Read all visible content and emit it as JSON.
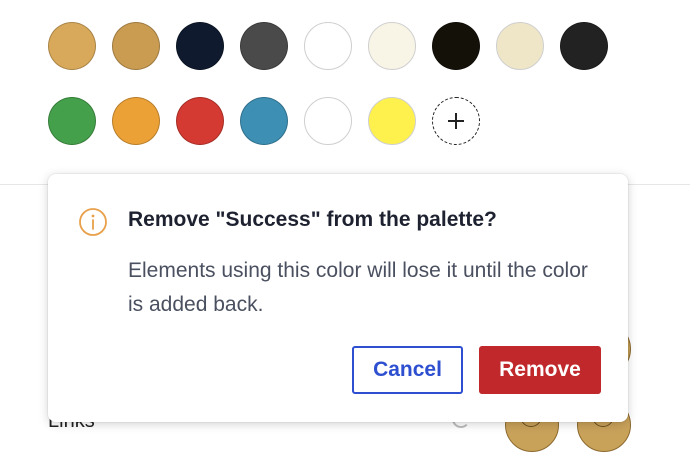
{
  "palette": {
    "row1": [
      {
        "name": "swatch-gold",
        "color": "#d8a95a"
      },
      {
        "name": "swatch-ochre",
        "color": "#c99c52"
      },
      {
        "name": "swatch-navy",
        "color": "#0f1a2e"
      },
      {
        "name": "swatch-dark-gray",
        "color": "#4a4a4a"
      },
      {
        "name": "swatch-white",
        "color": "#ffffff"
      },
      {
        "name": "swatch-ivory",
        "color": "#f8f5e6"
      },
      {
        "name": "swatch-black-olive",
        "color": "#141109"
      },
      {
        "name": "swatch-cream",
        "color": "#efe6c8"
      },
      {
        "name": "swatch-charcoal",
        "color": "#222222"
      }
    ],
    "row2": [
      {
        "name": "swatch-green",
        "color": "#45a04b"
      },
      {
        "name": "swatch-orange",
        "color": "#eba136"
      },
      {
        "name": "swatch-red",
        "color": "#d43a31"
      },
      {
        "name": "swatch-teal-blue",
        "color": "#3d8fb3"
      },
      {
        "name": "swatch-white-2",
        "color": "#ffffff"
      },
      {
        "name": "swatch-yellow",
        "color": "#fff14d"
      }
    ],
    "add_icon": "plus-icon"
  },
  "background": {
    "links_label": "Links"
  },
  "dialog": {
    "icon": "info-circle-icon",
    "title": "Remove \"Success\" from the palette?",
    "body": "Elements using this color will lose it until the color is added back.",
    "cancel_label": "Cancel",
    "remove_label": "Remove"
  },
  "colors": {
    "accent_blue": "#2d4fd0",
    "danger_red": "#c0282b",
    "warning_orange": "#e8a04a"
  }
}
